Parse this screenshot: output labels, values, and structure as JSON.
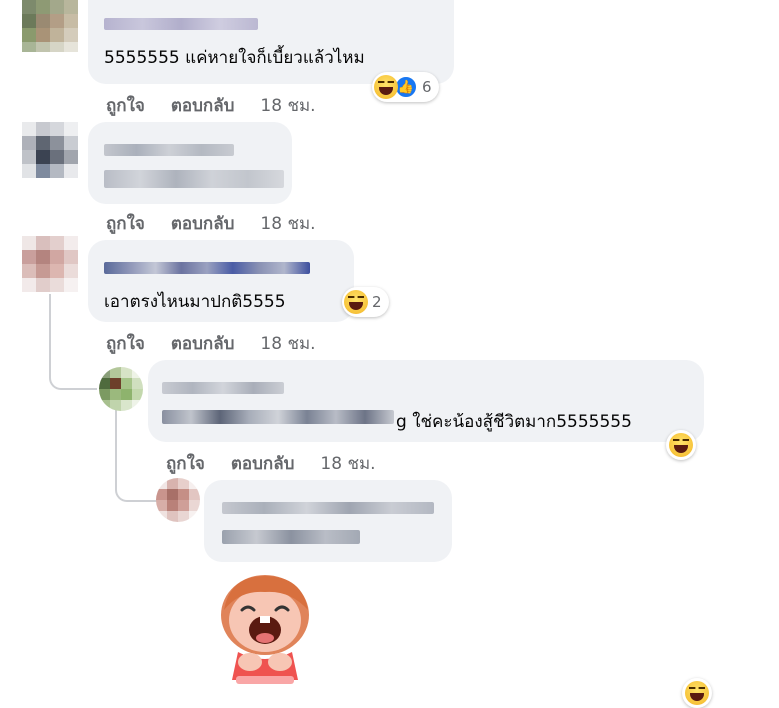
{
  "actions": {
    "like": "ถูกใจ",
    "reply": "ตอบกลับ"
  },
  "comments": [
    {
      "text": "5555555 แค่หายใจก็เบี้ยวแล้วไหม",
      "time": "18 ชม.",
      "reaction_count": "6"
    },
    {
      "text": "",
      "time": "18 ชม."
    },
    {
      "text": "เอาตรงไหนมาปกติ5555",
      "time": "18 ชม.",
      "reaction_count": "2"
    },
    {
      "text_suffix": "g ใช่คะน้องสู้ชีวิตมาก5555555",
      "time": "18 ชม."
    },
    {
      "text": ""
    }
  ],
  "colors": {
    "bubble": "#f0f2f5",
    "meta_text": "#65676b",
    "like_blue": "#1877f2",
    "laugh_yellow": "#f7c33a"
  },
  "icons": [
    "laugh-reaction-icon",
    "like-reaction-icon",
    "laughing-girl-sticker"
  ]
}
